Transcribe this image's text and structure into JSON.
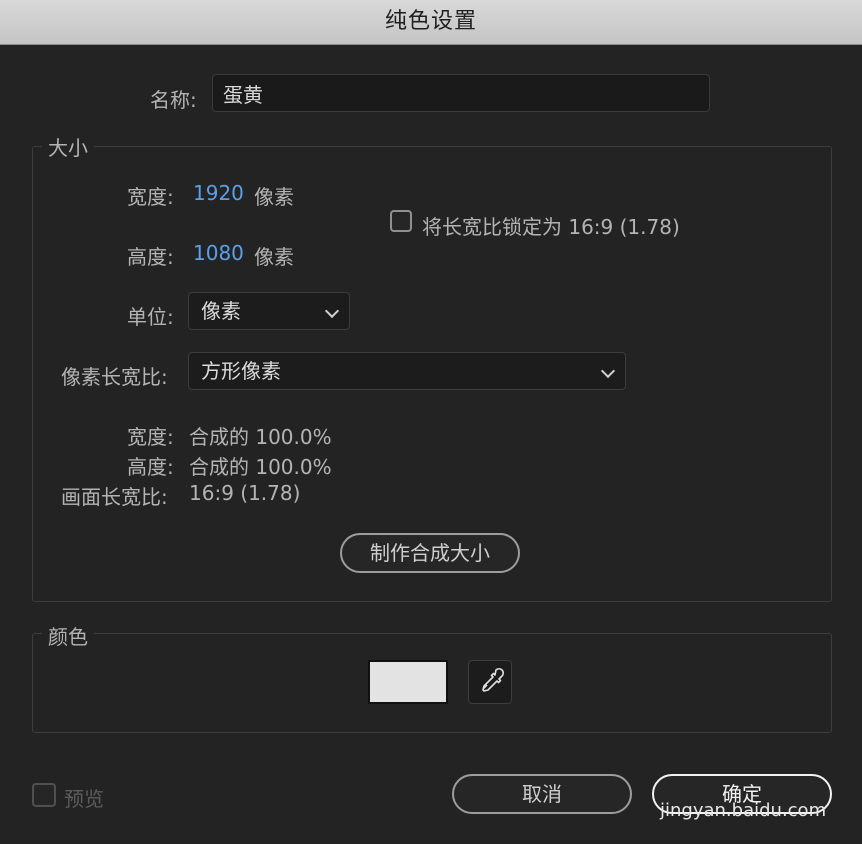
{
  "window": {
    "title": "纯色设置"
  },
  "name_field": {
    "label": "名称:",
    "value": "蛋黄"
  },
  "size_group": {
    "title": "大小",
    "width_label": "宽度:",
    "width_value": "1920",
    "width_unit": "像素",
    "height_label": "高度:",
    "height_value": "1080",
    "height_unit": "像素",
    "lock_aspect_label": "将长宽比锁定为 16:9 (1.78)",
    "lock_aspect_checked": false,
    "units_label": "单位:",
    "units_value": "像素",
    "pixel_aspect_label": "像素长宽比:",
    "pixel_aspect_value": "方形像素",
    "info_width_label": "宽度:",
    "info_width_value": "合成的 100.0%",
    "info_height_label": "高度:",
    "info_height_value": "合成的 100.0%",
    "frame_aspect_label": "画面长宽比:",
    "frame_aspect_value": "16:9 (1.78)",
    "make_comp_size_label": "制作合成大小"
  },
  "color_group": {
    "title": "颜色",
    "swatch_color": "#e3e3e3"
  },
  "footer": {
    "preview_label": "预览",
    "preview_checked": false,
    "cancel_label": "取消",
    "ok_label": "确定"
  },
  "watermark": {
    "text": "jingyan.baidu.com"
  },
  "colors": {
    "background": "#232323",
    "accent_blue": "#5aa0ea",
    "titlebar": "#d0d0d0"
  }
}
